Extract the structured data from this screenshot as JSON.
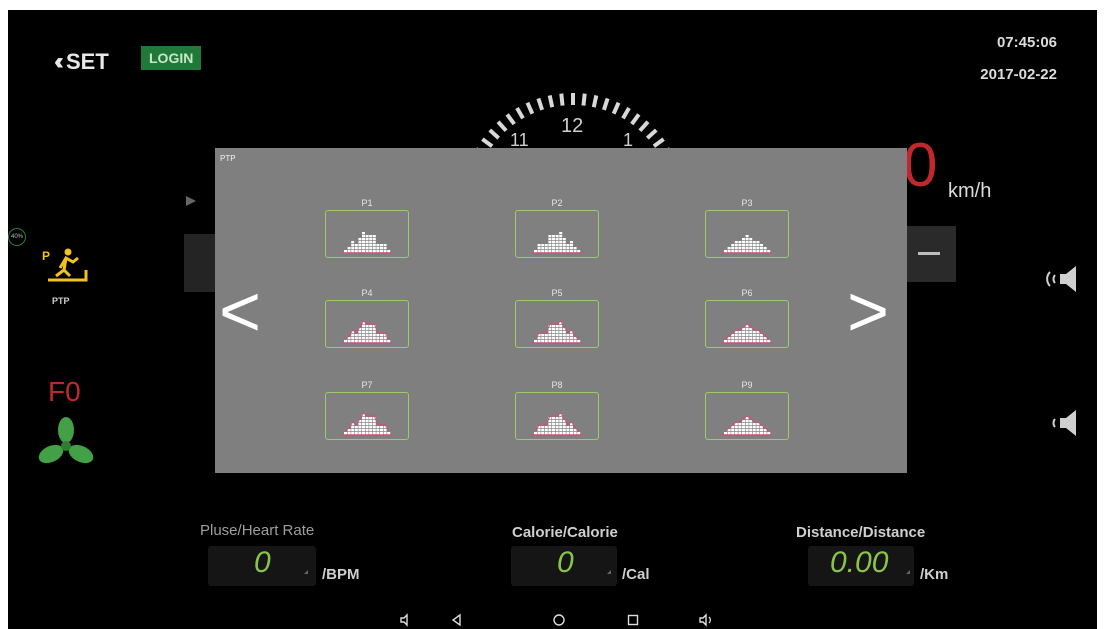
{
  "header": {
    "set_label": "SET",
    "login_label": "LOGIN",
    "time": "07:45:06",
    "date": "2017-02-22"
  },
  "dial": {
    "numbers": [
      "11",
      "12",
      "1"
    ]
  },
  "speed": {
    "value": "0",
    "unit": "km/h"
  },
  "left_panel": {
    "battery_percent": "40%",
    "program_label": "PTP",
    "fan_label": "F0"
  },
  "overlay": {
    "title": "PTP",
    "prev_arrow": "<",
    "next_arrow": ">",
    "programs": [
      {
        "label": "P1"
      },
      {
        "label": "P2"
      },
      {
        "label": "P3"
      },
      {
        "label": "P4"
      },
      {
        "label": "P5"
      },
      {
        "label": "P6"
      },
      {
        "label": "P7"
      },
      {
        "label": "P8"
      },
      {
        "label": "P9"
      }
    ]
  },
  "metrics": [
    {
      "label": "Pluse/Heart Rate",
      "value": "0",
      "unit": "/BPM"
    },
    {
      "label": "Calorie/Calorie",
      "value": "0",
      "unit": "/Cal"
    },
    {
      "label": "Distance/Distance",
      "value": "0.00",
      "unit": "/Km"
    }
  ],
  "nav_icons": [
    "volume-down-icon",
    "back-icon",
    "home-icon",
    "recents-icon",
    "volume-up-icon"
  ],
  "colors": {
    "accent_green": "#8bc34a",
    "speed_red": "#c0282e",
    "login_bg": "#1f7a3a",
    "chart_pink": "#e0457b",
    "panel_gray": "#7f7f7f"
  }
}
